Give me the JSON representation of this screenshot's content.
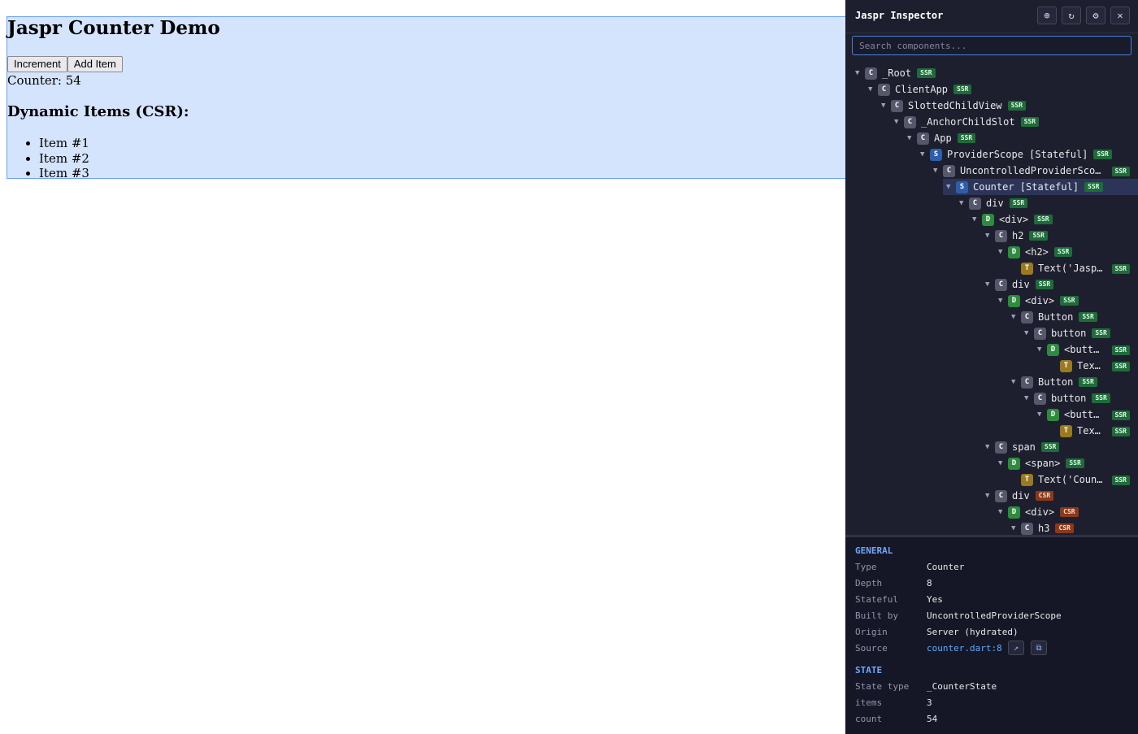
{
  "demo": {
    "title": "Jaspr Counter Demo",
    "buttons": {
      "increment": "Increment",
      "add_item": "Add Item"
    },
    "counter_text": "Counter: 54",
    "items_heading": "Dynamic Items (CSR):",
    "items": [
      "Item #1",
      "Item #2",
      "Item #3"
    ]
  },
  "inspector": {
    "title": "Jaspr Inspector",
    "tools": [
      {
        "name": "inspect-target-icon",
        "glyph": "⊕"
      },
      {
        "name": "refresh-icon",
        "glyph": "↻"
      },
      {
        "name": "settings-gear-icon",
        "glyph": "⚙"
      },
      {
        "name": "close-icon",
        "glyph": "✕"
      }
    ],
    "search_placeholder": "Search components...",
    "tree": [
      {
        "depth": 0,
        "kind": "C",
        "label": "_Root",
        "mode": "SSR"
      },
      {
        "depth": 1,
        "kind": "C",
        "label": "ClientApp",
        "mode": "SSR"
      },
      {
        "depth": 2,
        "kind": "C",
        "label": "SlottedChildView",
        "mode": "SSR"
      },
      {
        "depth": 3,
        "kind": "C",
        "label": "_AnchorChildSlot",
        "mode": "SSR"
      },
      {
        "depth": 4,
        "kind": "C",
        "label": "App",
        "mode": "SSR"
      },
      {
        "depth": 5,
        "kind": "S",
        "label": "ProviderScope [Stateful]",
        "mode": "SSR"
      },
      {
        "depth": 6,
        "kind": "C",
        "label": "UncontrolledProviderSco…",
        "mode": "SSR",
        "fixed_badge": true
      },
      {
        "depth": 7,
        "kind": "S",
        "label": "Counter [Stateful]",
        "mode": "SSR",
        "selected": true
      },
      {
        "depth": 8,
        "kind": "C",
        "label": "div",
        "mode": "SSR"
      },
      {
        "depth": 9,
        "kind": "D",
        "label": "<div>",
        "mode": "SSR"
      },
      {
        "depth": 10,
        "kind": "C",
        "label": "h2",
        "mode": "SSR"
      },
      {
        "depth": 11,
        "kind": "D",
        "label": "<h2>",
        "mode": "SSR"
      },
      {
        "depth": 12,
        "kind": "T",
        "label": "Text('Jasp…",
        "mode": "SSR",
        "leaf": true,
        "fixed_badge": true
      },
      {
        "depth": 10,
        "kind": "C",
        "label": "div",
        "mode": "SSR"
      },
      {
        "depth": 11,
        "kind": "D",
        "label": "<div>",
        "mode": "SSR"
      },
      {
        "depth": 12,
        "kind": "C",
        "label": "Button",
        "mode": "SSR"
      },
      {
        "depth": 13,
        "kind": "C",
        "label": "button",
        "mode": "SSR"
      },
      {
        "depth": 14,
        "kind": "D",
        "label": "<butt…",
        "mode": "SSR",
        "fixed_badge": true
      },
      {
        "depth": 15,
        "kind": "T",
        "label": "Tex…",
        "mode": "SSR",
        "leaf": true,
        "fixed_badge": true
      },
      {
        "depth": 12,
        "kind": "C",
        "label": "Button",
        "mode": "SSR"
      },
      {
        "depth": 13,
        "kind": "C",
        "label": "button",
        "mode": "SSR"
      },
      {
        "depth": 14,
        "kind": "D",
        "label": "<butt…",
        "mode": "SSR",
        "fixed_badge": true
      },
      {
        "depth": 15,
        "kind": "T",
        "label": "Tex…",
        "mode": "SSR",
        "leaf": true,
        "fixed_badge": true
      },
      {
        "depth": 10,
        "kind": "C",
        "label": "span",
        "mode": "SSR"
      },
      {
        "depth": 11,
        "kind": "D",
        "label": "<span>",
        "mode": "SSR"
      },
      {
        "depth": 12,
        "kind": "T",
        "label": "Text('Coun…",
        "mode": "SSR",
        "leaf": true,
        "fixed_badge": true
      },
      {
        "depth": 10,
        "kind": "C",
        "label": "div",
        "mode": "CSR"
      },
      {
        "depth": 11,
        "kind": "D",
        "label": "<div>",
        "mode": "CSR"
      },
      {
        "depth": 12,
        "kind": "C",
        "label": "h3",
        "mode": "CSR"
      }
    ],
    "details": {
      "general_heading": "GENERAL",
      "general": [
        {
          "key": "Type",
          "value": "Counter"
        },
        {
          "key": "Depth",
          "value": "8"
        },
        {
          "key": "Stateful",
          "value": "Yes"
        },
        {
          "key": "Built by",
          "value": "UncontrolledProviderScope"
        },
        {
          "key": "Origin",
          "value": "Server (hydrated)"
        },
        {
          "key": "Source",
          "value": "counter.dart:8",
          "link": true
        }
      ],
      "source_buttons": [
        {
          "name": "open-in-editor-icon",
          "glyph": "↗"
        },
        {
          "name": "copy-path-icon",
          "glyph": "⧉"
        }
      ],
      "state_heading": "STATE",
      "state": [
        {
          "key": "State type",
          "value": "_CounterState"
        },
        {
          "key": "items",
          "value": "3"
        },
        {
          "key": "count",
          "value": "54"
        }
      ]
    }
  }
}
